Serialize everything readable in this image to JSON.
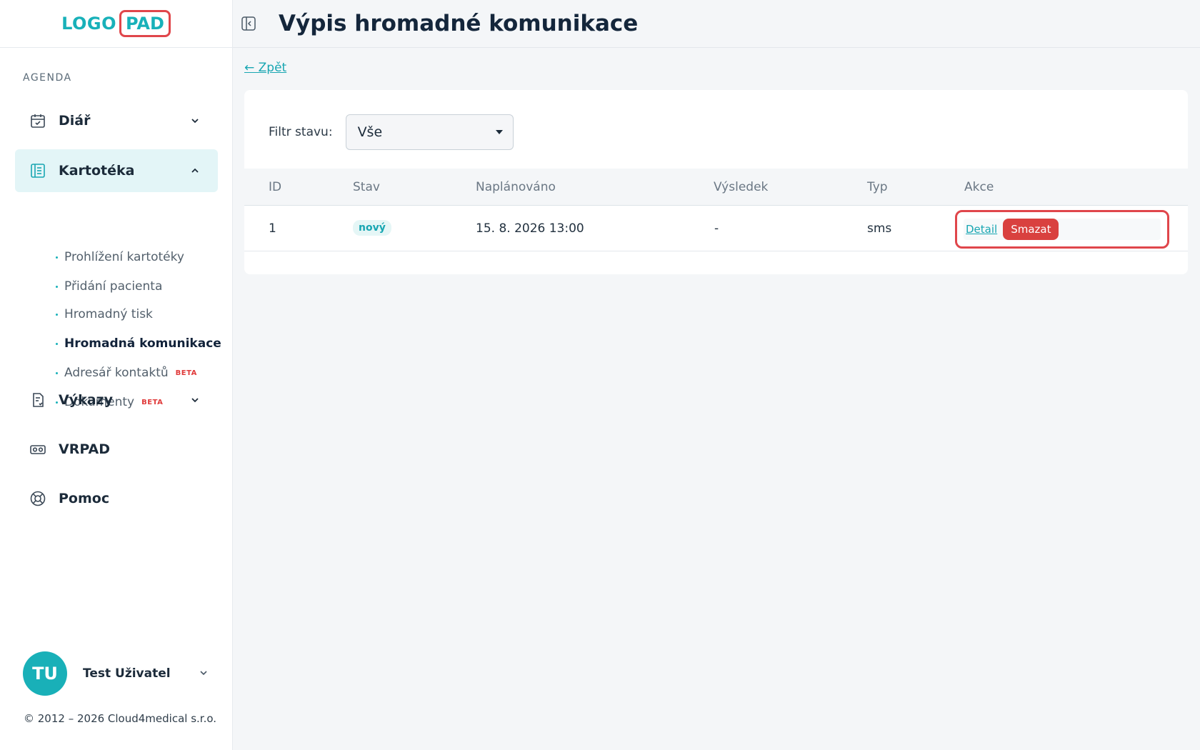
{
  "logo": {
    "left": "LOGO",
    "right": "PAD"
  },
  "sidebar": {
    "section": "AGENDA",
    "items": [
      {
        "label": "Diář",
        "icon": "calendar-icon"
      },
      {
        "label": "Kartotéka",
        "icon": "file-list-icon"
      },
      {
        "label": "Výkazy",
        "icon": "report-icon"
      },
      {
        "label": "VRPAD",
        "icon": "vr-headset-icon"
      },
      {
        "label": "Pomoc",
        "icon": "lifebuoy-icon"
      }
    ],
    "subitems": [
      {
        "label": "Prohlížení kartotéky"
      },
      {
        "label": "Přidání pacienta"
      },
      {
        "label": "Hromadný tisk"
      },
      {
        "label": "Hromadná komunikace"
      },
      {
        "label": "Adresář kontaktů",
        "badge": "BETA"
      },
      {
        "label": "Dokumenty",
        "badge": "BETA"
      }
    ]
  },
  "user": {
    "initials": "TU",
    "name": "Test Uživatel"
  },
  "footer": {
    "copyright": "© 2012 – 2026 Cloud4medical s.r.o."
  },
  "header": {
    "title": "Výpis hromadné komunikace"
  },
  "back": {
    "label": "← Zpět"
  },
  "filter": {
    "label": "Filtr stavu:",
    "value": "Vše"
  },
  "table": {
    "columns": [
      "ID",
      "Stav",
      "Naplánováno",
      "Výsledek",
      "Typ",
      "Akce"
    ],
    "rows": [
      {
        "id": "1",
        "status": "nový",
        "scheduled": "15. 8. 2026 13:00",
        "result": "-",
        "type": "sms",
        "detail": "Detail",
        "delete": "Smazat"
      }
    ]
  },
  "colors": {
    "accent": "#18b1b9",
    "danger": "#d9413f",
    "highlight": "#e0464b"
  }
}
